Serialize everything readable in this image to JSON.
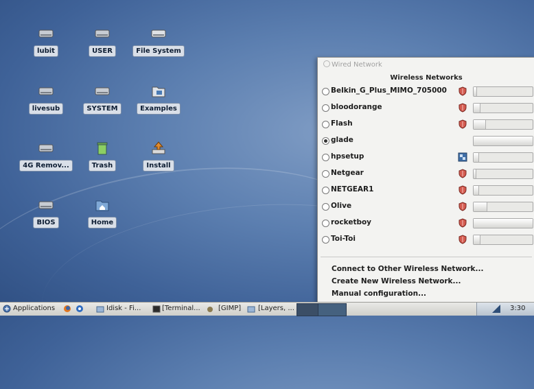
{
  "desktop": {
    "icons": [
      {
        "label": "lubit",
        "icon": "drive-icon"
      },
      {
        "label": "USER",
        "icon": "drive-icon"
      },
      {
        "label": "File System",
        "icon": "drive-icon"
      },
      {
        "label": "livesub",
        "icon": "drive-icon"
      },
      {
        "label": "SYSTEM",
        "icon": "drive-icon"
      },
      {
        "label": "Examples",
        "icon": "folder-icon"
      },
      {
        "label": "4G Remov...",
        "icon": "drive-icon"
      },
      {
        "label": "Trash",
        "icon": "trash-icon"
      },
      {
        "label": "Install",
        "icon": "install-icon"
      },
      {
        "label": "BIOS",
        "icon": "drive-icon"
      },
      {
        "label": "Home",
        "icon": "home-folder-icon"
      }
    ]
  },
  "network_menu": {
    "wired_label": "Wired Network",
    "wireless_title": "Wireless Networks",
    "networks": [
      {
        "name": "Belkin_G_Plus_MIMO_705000",
        "selected": false,
        "security_icon": "shield-icon",
        "signal": 0.05
      },
      {
        "name": "bloodorange",
        "selected": false,
        "security_icon": "shield-icon",
        "signal": 0.1
      },
      {
        "name": "Flash",
        "selected": false,
        "security_icon": "shield-icon",
        "signal": 0.2
      },
      {
        "name": "glade",
        "selected": true,
        "security_icon": "",
        "signal": 1.0
      },
      {
        "name": "hpsetup",
        "selected": false,
        "security_icon": "adhoc-icon",
        "signal": 0.08
      },
      {
        "name": "Netgear",
        "selected": false,
        "security_icon": "shield-icon",
        "signal": 0.04
      },
      {
        "name": "NETGEAR1",
        "selected": false,
        "security_icon": "shield-icon",
        "signal": 0.08
      },
      {
        "name": "Olive",
        "selected": false,
        "security_icon": "shield-icon",
        "signal": 0.22
      },
      {
        "name": "rocketboy",
        "selected": false,
        "security_icon": "shield-icon",
        "signal": 1.0
      },
      {
        "name": "Toi-Toi",
        "selected": false,
        "security_icon": "shield-icon",
        "signal": 0.1
      }
    ],
    "actions": [
      "Connect to Other Wireless Network...",
      "Create New Wireless Network...",
      "Manual configuration..."
    ]
  },
  "taskbar": {
    "applications_label": "Applications",
    "tasks": [
      "Idisk - Fi...",
      "[Terminal...",
      "[GIMP]",
      "[Layers, ..."
    ],
    "clock": "3:30"
  }
}
